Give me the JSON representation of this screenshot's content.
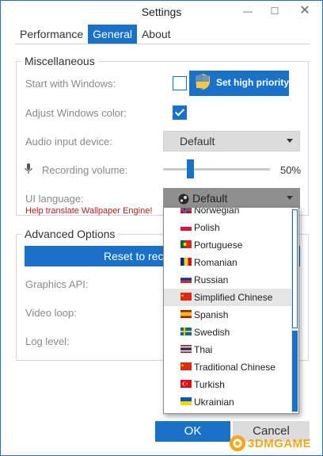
{
  "window": {
    "title": "Settings",
    "min_glyph": "—",
    "max_glyph": "☐",
    "close_glyph": "✕"
  },
  "tabs": [
    {
      "label": "Performance",
      "active": false
    },
    {
      "label": "General",
      "active": true
    },
    {
      "label": "About",
      "active": false
    }
  ],
  "misc": {
    "title": "Miscellaneous",
    "start_with_windows": {
      "label": "Start with Windows:",
      "checked": false
    },
    "high_priority_button": "Set high priority",
    "adjust_color": {
      "label": "Adjust Windows color:",
      "checked": true
    },
    "audio_device": {
      "label": "Audio input device:",
      "value": "Default"
    },
    "recording_volume": {
      "label": "Recording volume:",
      "value": "50%",
      "level": 0.5
    },
    "ui_language": {
      "label": "UI language:",
      "value": "Default"
    },
    "help_link": "Help translate Wallpaper Engine!"
  },
  "advanced": {
    "title": "Advanced Options",
    "reset_button": "Reset to rec",
    "graphics_api_label": "Graphics API:",
    "video_loop_label": "Video loop:",
    "log_level_label": "Log level:"
  },
  "language_dropdown": {
    "items": [
      {
        "label": "Norwegian",
        "flag": "norway-flag"
      },
      {
        "label": "Polish",
        "flag": "poland-flag"
      },
      {
        "label": "Portuguese",
        "flag": "portugal-flag"
      },
      {
        "label": "Romanian",
        "flag": "romania-flag"
      },
      {
        "label": "Russian",
        "flag": "russia-flag"
      },
      {
        "label": "Simplified Chinese",
        "flag": "china-flag",
        "highlighted": true
      },
      {
        "label": "Spanish",
        "flag": "spain-flag"
      },
      {
        "label": "Swedish",
        "flag": "sweden-flag"
      },
      {
        "label": "Thai",
        "flag": "thailand-flag"
      },
      {
        "label": "Traditional Chinese",
        "flag": "taiwan-flag"
      },
      {
        "label": "Turkish",
        "flag": "turkey-flag"
      },
      {
        "label": "Ukrainian",
        "flag": "ukraine-flag"
      }
    ]
  },
  "footer": {
    "ok": "OK",
    "cancel": "Cancel"
  },
  "watermark": "3DMGAME",
  "colors": {
    "accent": "#1a72c8",
    "link": "#b42020",
    "combo_bg": "#dcdcdc"
  }
}
